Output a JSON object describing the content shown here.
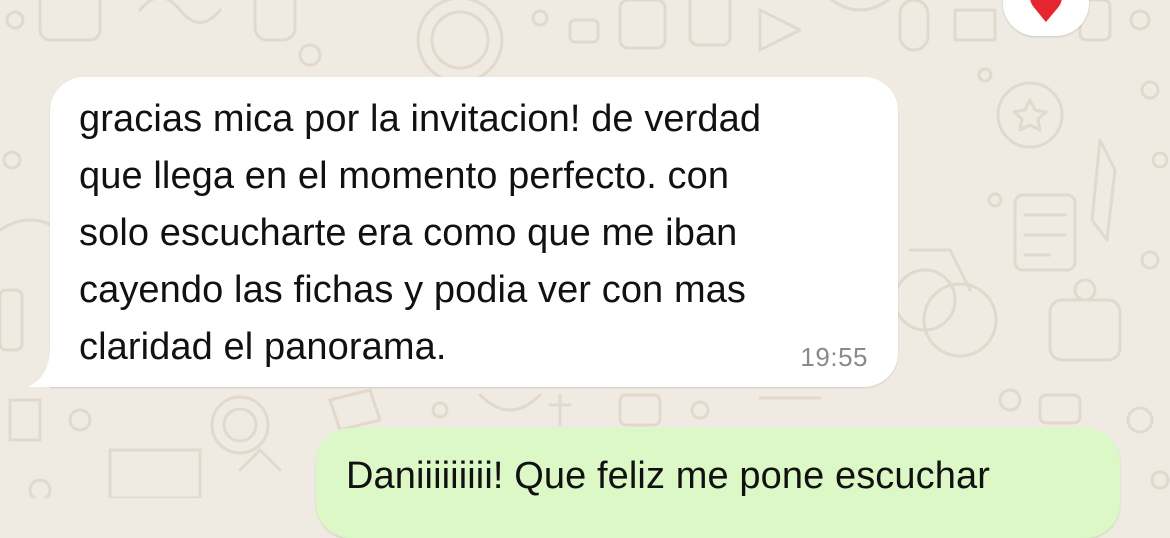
{
  "chat": {
    "background_color": "#efeae2",
    "doodle_color": "#e3dbd1",
    "incoming_message": {
      "text": "gracias mica por la invitacion! de verdad\nque llega en el momento perfecto. con\nsolo escucharte era como que me iban\ncayendo las fichas y podia ver con mas\nclaridad el panorama.",
      "time": "19:55",
      "bubble_color": "#ffffff"
    },
    "outgoing_message": {
      "text": "Daniiiiiiiii! Que feliz me pone escuchar",
      "bubble_color": "#dcf8c6"
    },
    "reaction": {
      "emoji": "heart-icon",
      "color": "#e5262f"
    }
  }
}
